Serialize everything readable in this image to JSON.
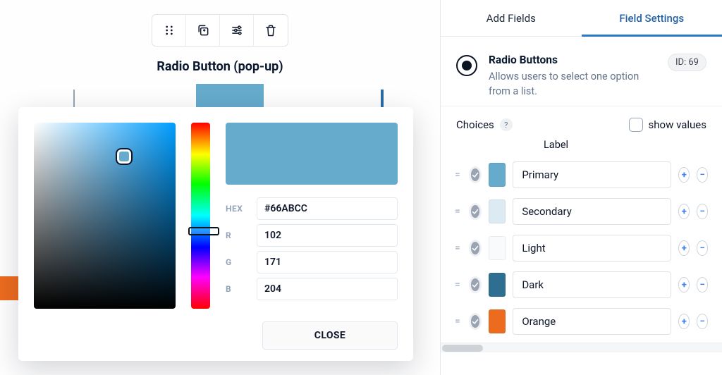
{
  "field": {
    "title": "Radio Button (pop-up)"
  },
  "picker": {
    "hexLabel": "HEX",
    "rLabel": "R",
    "gLabel": "G",
    "bLabel": "B",
    "hex": "#66ABCC",
    "r": "102",
    "g": "171",
    "b": "204",
    "closeLabel": "CLOSE",
    "swatchColor": "#66ABCC"
  },
  "rightPanel": {
    "tabs": {
      "addFields": "Add Fields",
      "fieldSettings": "Field Settings"
    },
    "fieldName": "Radio Buttons",
    "fieldDesc": "Allows users to select one option from a list.",
    "idBadge": "ID: 69",
    "choicesLabel": "Choices",
    "showValuesLabel": "show values",
    "labelHeader": "Label",
    "choices": [
      {
        "label": "Primary",
        "color": "#66ABCC"
      },
      {
        "label": "Secondary",
        "color": "#dcebf3"
      },
      {
        "label": "Light",
        "color": "#f9fafb"
      },
      {
        "label": "Dark",
        "color": "#2d6e91"
      },
      {
        "label": "Orange",
        "color": "#ed6b1f"
      }
    ]
  }
}
